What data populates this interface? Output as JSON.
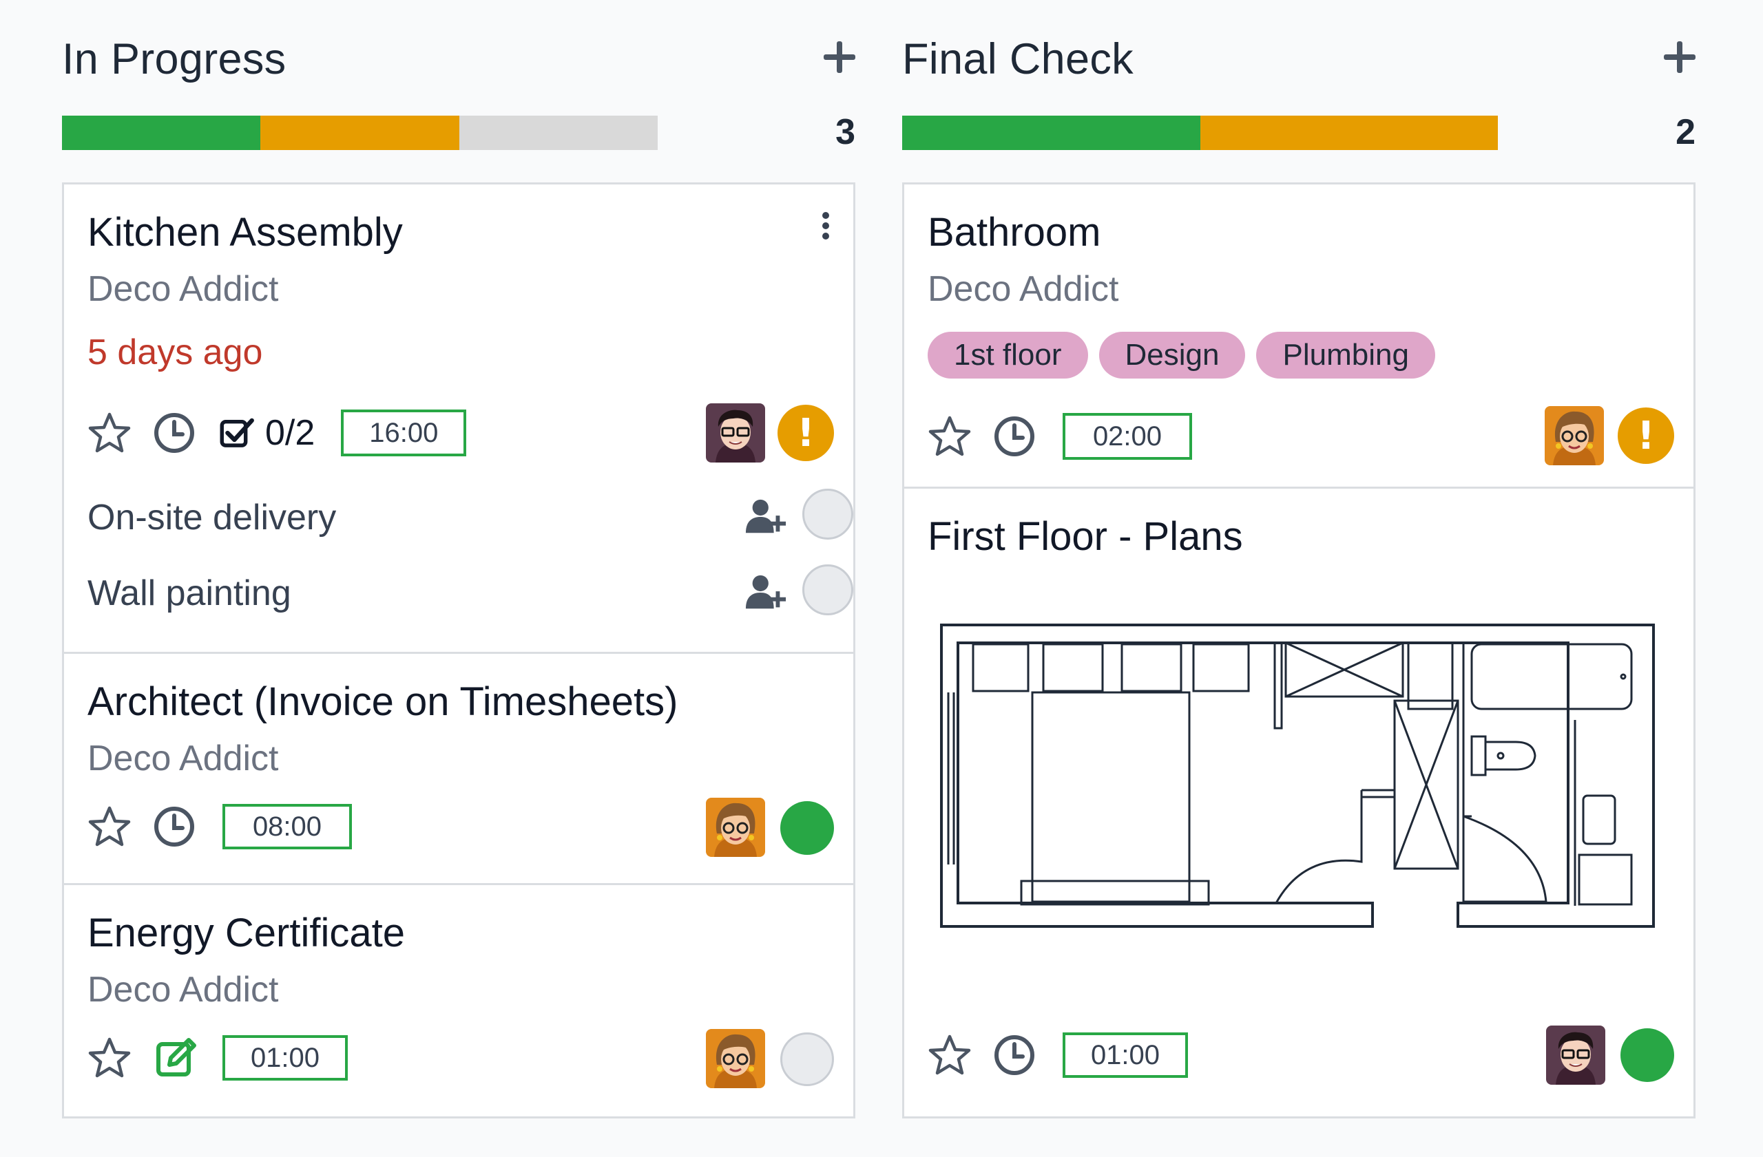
{
  "colors": {
    "green": "#28a745",
    "orange": "#e69d00",
    "grey": "#d9d9d9",
    "date_red": "#c0392b",
    "tag_pink": "#dfa6c9"
  },
  "columns": [
    {
      "title": "In Progress",
      "count": "3",
      "progress": {
        "done": 1,
        "blocked": 1,
        "normal": 1,
        "total": 3
      },
      "add_icon": "plus-icon",
      "cards": [
        {
          "title": "Kitchen Assembly",
          "customer": "Deco Addict",
          "deadline": "5 days ago",
          "subtasks": "0/2",
          "time": "16:00",
          "status": "blocked",
          "status_glyph": "!",
          "checklist": [
            {
              "label": "On-site delivery"
            },
            {
              "label": "Wall painting"
            }
          ]
        },
        {
          "title": "Architect (Invoice on Timesheets)",
          "customer": "Deco Addict",
          "time": "08:00",
          "status": "done"
        },
        {
          "title": "Energy Certificate",
          "customer": "Deco Addict",
          "time": "01:00",
          "status": "normal"
        }
      ]
    },
    {
      "title": "Final Check",
      "count": "2",
      "progress": {
        "done": 1,
        "blocked": 1,
        "normal": 0,
        "total": 2
      },
      "add_icon": "plus-icon",
      "cards": [
        {
          "title": "Bathroom",
          "customer": "Deco Addict",
          "tags": [
            "1st floor",
            "Design",
            "Plumbing"
          ],
          "time": "02:00",
          "status": "blocked",
          "status_glyph": "!"
        },
        {
          "title": "First Floor - Plans",
          "time": "01:00",
          "status": "done"
        }
      ]
    }
  ]
}
